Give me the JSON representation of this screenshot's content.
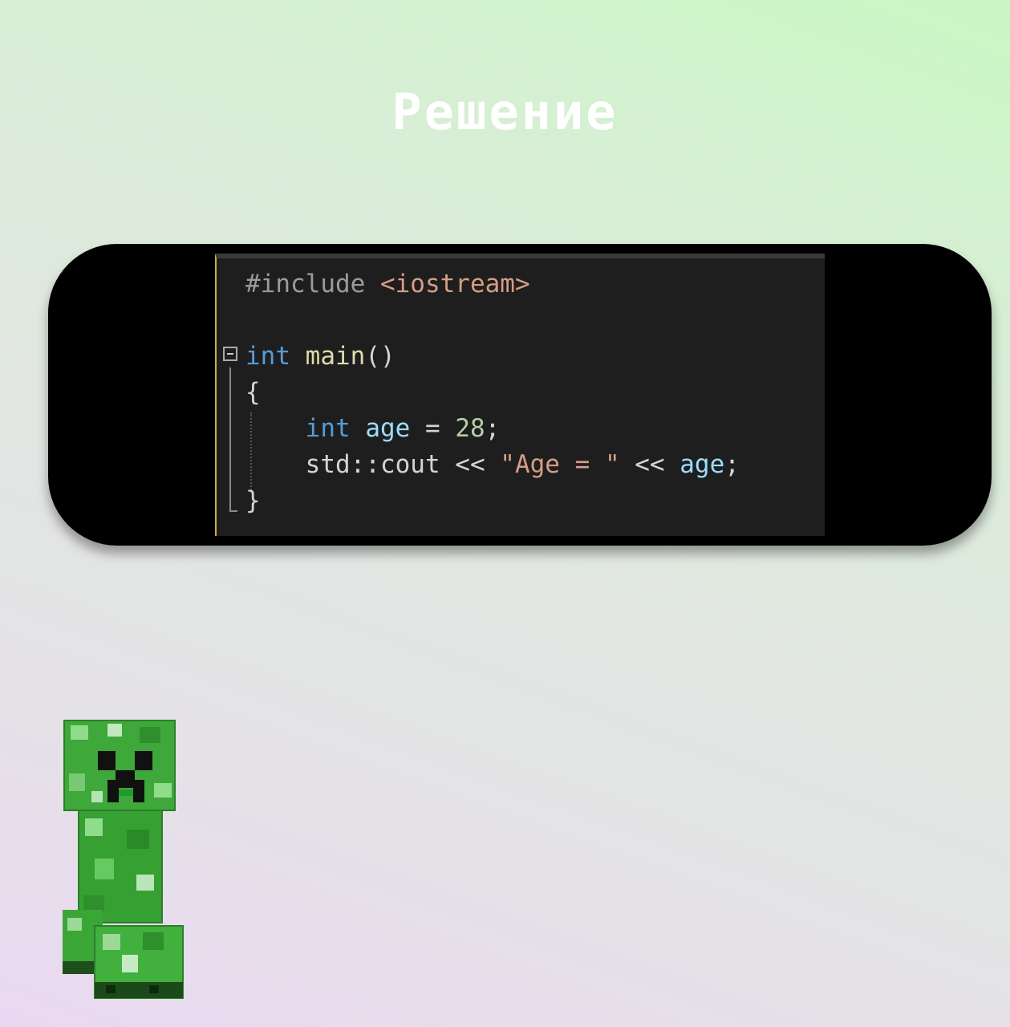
{
  "title": "Решение",
  "code": {
    "lines": [
      [
        "#include ",
        "<iostream>"
      ],
      [],
      [
        "int",
        " ",
        "main",
        "()"
      ],
      [
        "{"
      ],
      [
        "    ",
        "int",
        " ",
        "age",
        " = ",
        "28",
        ";"
      ],
      [
        "    ",
        "std::cout << ",
        "\"Age = \"",
        " << ",
        "age",
        ";"
      ],
      [
        "}"
      ]
    ]
  }
}
